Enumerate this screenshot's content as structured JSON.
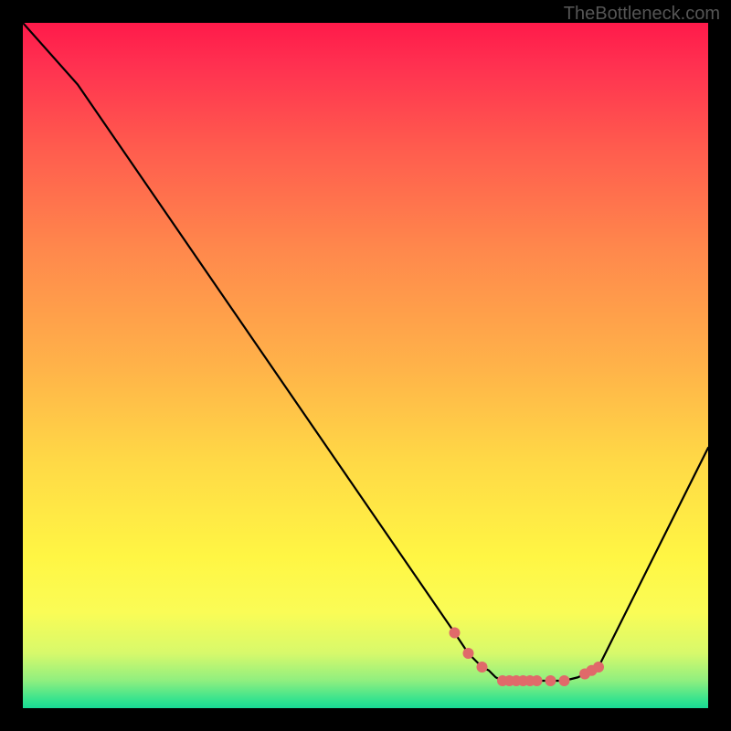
{
  "watermark": "TheBottleneck.com",
  "chart_data": {
    "type": "line",
    "title": "",
    "xlabel": "",
    "ylabel": "",
    "xlim": [
      0,
      100
    ],
    "ylim": [
      0,
      100
    ],
    "series": [
      {
        "name": "curve",
        "x": [
          0,
          8,
          63,
          65,
          67,
          68,
          69,
          70,
          71,
          72,
          73,
          74,
          75,
          77,
          79,
          81,
          82,
          83,
          84,
          85,
          100
        ],
        "y": [
          100,
          91,
          11,
          8,
          6,
          5.5,
          4.5,
          4,
          4,
          4,
          4,
          4,
          4,
          4,
          4,
          4.5,
          5,
          5.5,
          6,
          8,
          38
        ]
      }
    ],
    "markers": {
      "name": "highlight-dots",
      "color": "#e06a6a",
      "x": [
        63,
        65,
        67,
        70,
        71,
        72,
        73,
        74,
        75,
        77,
        79,
        82,
        83,
        84
      ],
      "y": [
        11,
        8,
        6,
        4,
        4,
        4,
        4,
        4,
        4,
        4,
        4,
        5,
        5.5,
        6
      ]
    }
  }
}
